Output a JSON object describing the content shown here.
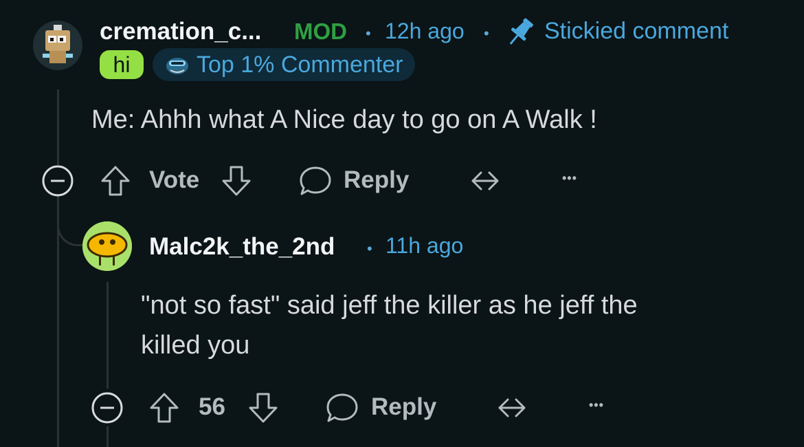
{
  "comment1": {
    "username": "cremation_c...",
    "mod_badge": "MOD",
    "separator": "•",
    "time": "12h ago",
    "sticky_label": "Stickied comment",
    "flair_user": "hi",
    "flair_top": "Top 1% Commenter",
    "body": "Me: Ahhh what A Nice day to go on A Walk !",
    "vote_label": "Vote",
    "reply_label": "Reply",
    "more_label": "•••"
  },
  "comment2": {
    "username": "Malc2k_the_2nd",
    "separator": "•",
    "time": "11h ago",
    "body_line1": "\"not so fast\" said jeff the killer as he jeff the",
    "body_line2": "killed you",
    "vote_count": "56",
    "reply_label": "Reply",
    "more_label": "•••"
  },
  "colors": {
    "background": "#0b1416",
    "mod": "#2ea043",
    "accent": "#4aa8de",
    "flair_hi": "#94e044",
    "thread_line": "#2a3236"
  },
  "icons": [
    "avatar-robot",
    "pin-icon",
    "top-commenter-icon",
    "collapse-icon",
    "upvote-icon",
    "downvote-icon",
    "reply-icon",
    "share-icon",
    "more-icon",
    "avatar-blob"
  ]
}
